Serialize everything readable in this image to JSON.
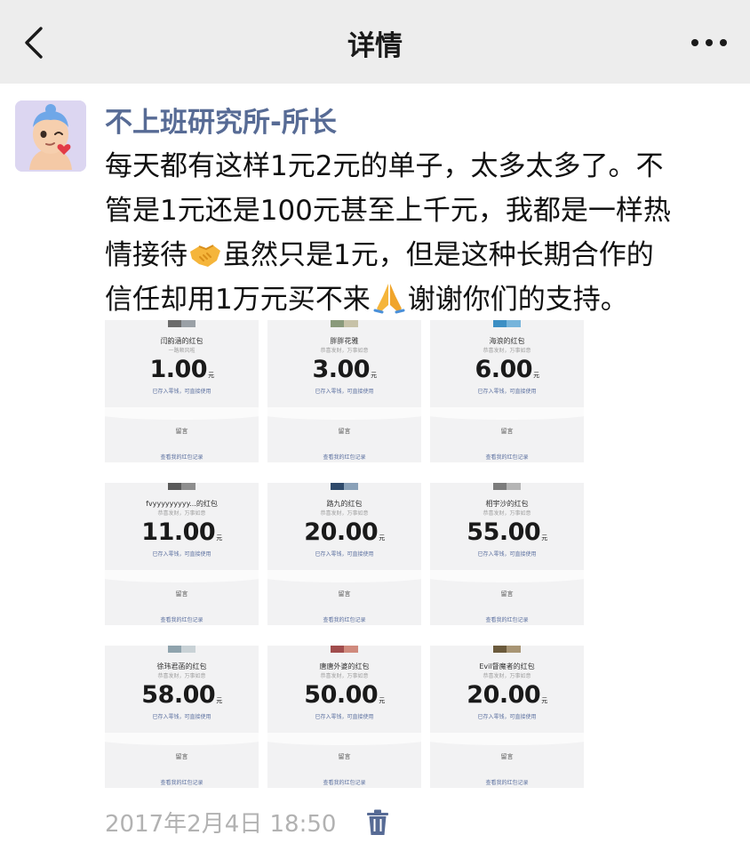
{
  "header": {
    "title": "详情"
  },
  "post": {
    "author": "不上班研究所-所长",
    "text_lines": [
      "每天都有这样1元2元的单子，太多太多了。不",
      "管是1元还是100元甚至上千元，我都是一样热",
      "情接待|handshake|虽然只是1元，但是这种长期合作的",
      "信任却用1万元买不来|pray|谢谢你们的支持。"
    ],
    "timestamp": "2017年2月4日 18:50"
  },
  "red_envelopes": [
    {
      "sender": "闫韵涵的红包",
      "sub": "一路顺风啦",
      "amount": "1.00",
      "unit": "元",
      "note": "已存入零钱，可直接使用",
      "msg": "留言",
      "link": "查看我的红包记录",
      "thumb": [
        "#6b6b6b",
        "#9aa0a6"
      ]
    },
    {
      "sender": "胖胖花雅",
      "sub": "恭喜发财，万事如意",
      "amount": "3.00",
      "unit": "元",
      "note": "已存入零钱，可直接使用",
      "msg": "留言",
      "link": "查看我的红包记录",
      "thumb": [
        "#8a9a7b",
        "#c7c2a8"
      ]
    },
    {
      "sender": "海浪的红包",
      "sub": "恭喜发财，万事如意",
      "amount": "6.00",
      "unit": "元",
      "note": "已存入零钱，可直接使用",
      "msg": "留言",
      "link": "查看我的红包记录",
      "thumb": [
        "#3c8fc4",
        "#76b4db"
      ]
    },
    {
      "sender": "fvyyyyyyyyy...的红包",
      "sub": "恭喜发财，万事如意",
      "amount": "11.00",
      "unit": "元",
      "note": "已存入零钱，可直接使用",
      "msg": "留言",
      "link": "查看我的红包记录",
      "thumb": [
        "#5a5a5a",
        "#8e8e8e"
      ]
    },
    {
      "sender": "路九的红包",
      "sub": "恭喜发财，万事如意",
      "amount": "20.00",
      "unit": "元",
      "note": "已存入零钱，可直接使用",
      "msg": "留言",
      "link": "查看我的红包记录",
      "thumb": [
        "#2f4a6b",
        "#8aa1b8"
      ]
    },
    {
      "sender": "相宇沙的红包",
      "sub": "恭喜发财，万事如意",
      "amount": "55.00",
      "unit": "元",
      "note": "已存入零钱，可直接使用",
      "msg": "留言",
      "link": "查看我的红包记录",
      "thumb": [
        "#7c7c7c",
        "#b5b5b5"
      ]
    },
    {
      "sender": "徐玮君菡的红包",
      "sub": "恭喜发财，万事如意",
      "amount": "58.00",
      "unit": "元",
      "note": "已存入零钱，可直接使用",
      "msg": "留言",
      "link": "查看我的红包记录",
      "thumb": [
        "#8fa3ad",
        "#c9d2d6"
      ]
    },
    {
      "sender": "唐唐外婆的红包",
      "sub": "恭喜发财，万事如意",
      "amount": "50.00",
      "unit": "元",
      "note": "已存入零钱，可直接使用",
      "msg": "留言",
      "link": "查看我的红包记录",
      "thumb": [
        "#a14d4d",
        "#d08a7d"
      ]
    },
    {
      "sender": "Evil督魔者的红包",
      "sub": "恭喜发财，万事如意",
      "amount": "20.00",
      "unit": "元",
      "note": "已存入零钱，可直接使用",
      "msg": "留言",
      "link": "查看我的红包记录",
      "thumb": [
        "#6b5a3c",
        "#a89574"
      ]
    }
  ],
  "icons": {
    "back": "chevron-left-icon",
    "more": "more-dots-icon",
    "delete": "trash-icon",
    "handshake": "handshake-emoji-icon",
    "pray": "praying-hands-emoji-icon"
  },
  "colors": {
    "nav_background": "#ededed",
    "author_link": "#576b95",
    "meta_text": "#b2b2b2",
    "card_background": "#f2f2f3",
    "trash_icon": "#576b95"
  }
}
